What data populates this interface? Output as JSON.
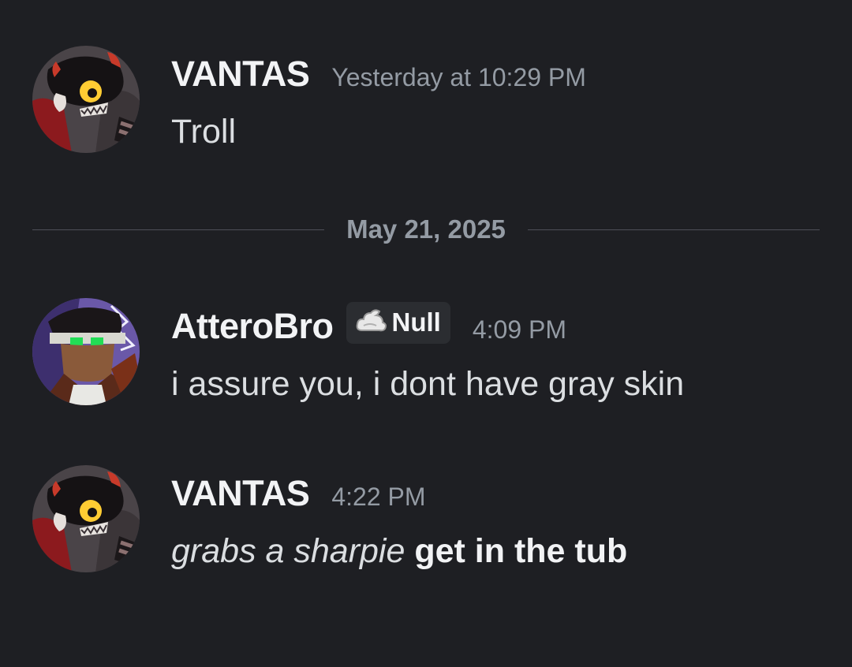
{
  "divider": {
    "date": "May 21, 2025"
  },
  "messages": [
    {
      "username": "VANTAS",
      "timestamp": "Yesterday at 10:29 PM",
      "text": "Troll",
      "avatar": "troll-avatar"
    },
    {
      "username": "AtteroBro",
      "tag_label": "Null",
      "tag_icon": "cloud-icon",
      "timestamp": "4:09 PM",
      "text": "i assure you, i dont have gray skin",
      "avatar": "glowing-eyes-avatar"
    },
    {
      "username": "VANTAS",
      "timestamp": "4:22 PM",
      "text_italic": "grabs a sharpie",
      "text_bold": "get in the tub",
      "avatar": "troll-avatar"
    }
  ],
  "colors": {
    "background": "#1e1f23",
    "username": "#f2f3f5",
    "timestamp": "#949ba4",
    "text": "#dbdee1",
    "tag_bg": "#2b2d31"
  }
}
